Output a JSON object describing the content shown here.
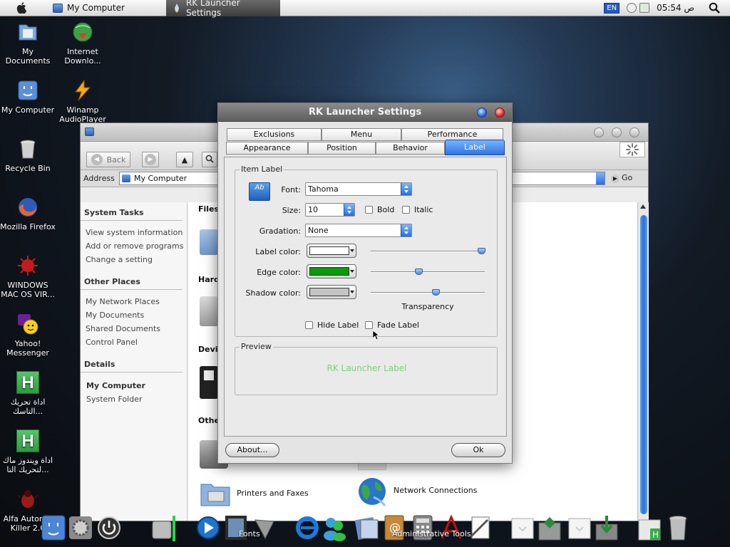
{
  "menubar": {
    "app_name": "My Computer",
    "active_app": "RK Launcher Settings",
    "language": "EN",
    "clock": "05:54 ص"
  },
  "desktop_icons": [
    {
      "label": "My Documents"
    },
    {
      "label": "Internet Downlo..."
    },
    {
      "label": "My Computer"
    },
    {
      "label": "Winamp AudioPlayer"
    },
    {
      "label": "Recycle Bin"
    },
    {
      "label": "Mozilla Firefox"
    },
    {
      "label": "WINDOWS MAC OS VIR..."
    },
    {
      "label": "Yahoo! Messenger"
    },
    {
      "label": "اداة تحريك التاسك..."
    },
    {
      "label": "اداة ويندوز ماك لتحريك التا..."
    },
    {
      "label": "Alfa Autorun Killer 2.0"
    }
  ],
  "explorer": {
    "back_label": "Back",
    "address_label": "Address",
    "address_value": "My Computer",
    "go_label": "Go",
    "system_tasks": {
      "title": "System Tasks",
      "items": [
        "View system information",
        "Add or remove programs",
        "Change a setting"
      ]
    },
    "other_places": {
      "title": "Other Places",
      "items": [
        "My Network Places",
        "My Documents",
        "Shared Documents",
        "Control Panel"
      ]
    },
    "details": {
      "title": "Details",
      "name": "My Computer",
      "type": "System Folder"
    },
    "groups": [
      "Files",
      "Hard",
      "Devic",
      "Othe"
    ],
    "items": [
      "Printers and Faxes",
      "Network Connections"
    ]
  },
  "dialog": {
    "title": "RK Launcher Settings",
    "tabs_row1": [
      "Exclusions",
      "Menu",
      "Performance"
    ],
    "tabs_row2": [
      "Appearance",
      "Position",
      "Behavior",
      "Label"
    ],
    "item_label": {
      "legend": "Item Label",
      "icon_text": "Ab",
      "font_label": "Font:",
      "font_value": "Tahoma",
      "size_label": "Size:",
      "size_value": "10",
      "bold_label": "Bold",
      "italic_label": "Italic",
      "gradation_label": "Gradation:",
      "gradation_value": "None",
      "label_color_label": "Label color:",
      "edge_color_label": "Edge color:",
      "shadow_color_label": "Shadow color:",
      "transparency_label": "Transparency",
      "hide_label": "Hide Label",
      "fade_label": "Fade Label"
    },
    "preview": {
      "legend": "Preview",
      "text": "RK Launcher Label"
    },
    "about_button": "About...",
    "ok_button": "Ok"
  },
  "dock": {
    "labels": [
      "Fonts",
      "Administrative Tools"
    ]
  },
  "colors": {
    "label_color": "#ffffff",
    "edge_color": "#0a9a0a",
    "shadow_color": "#c4c4c4",
    "preview_text": "#7ecf7e",
    "accent": "#2e74e4"
  },
  "sliders": {
    "label_color_fraction": 0.97,
    "edge_color_fraction": 0.42,
    "shadow_color_fraction": 0.57
  }
}
